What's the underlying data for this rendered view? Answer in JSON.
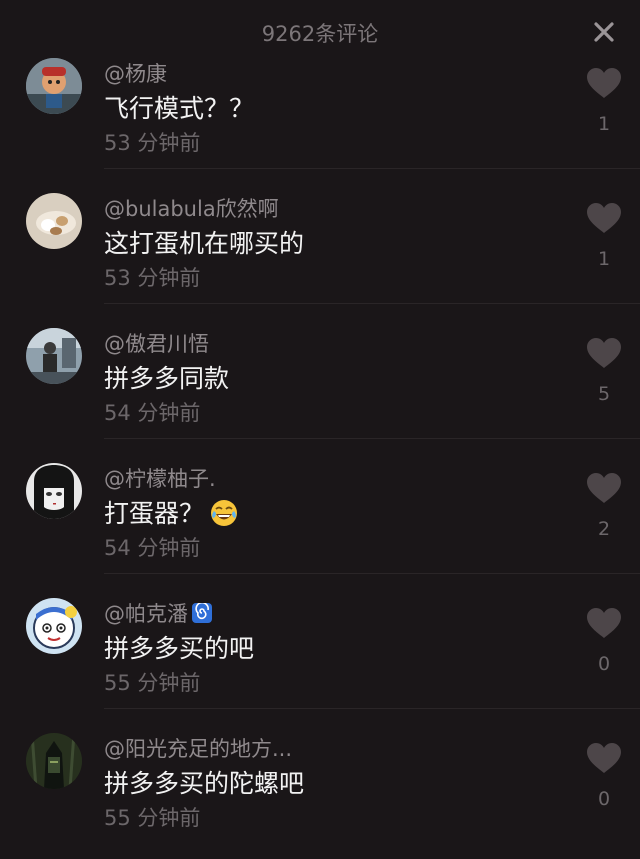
{
  "header": {
    "title": "9262条评论"
  },
  "comments": [
    {
      "username": "@杨康",
      "text": "飞行模式？？",
      "time": "53 分钟前",
      "likes": "1",
      "avatar_icon": "cartoon-figure-avatar"
    },
    {
      "username": "@bulabula欣然啊",
      "text": "这打蛋机在哪买的",
      "time": "53 分钟前",
      "likes": "1",
      "avatar_icon": "food-photo-avatar"
    },
    {
      "username": "@傲君川悟",
      "text": "拼多多同款",
      "time": "54 分钟前",
      "likes": "5",
      "avatar_icon": "person-photo-avatar"
    },
    {
      "username": "@柠檬柚子.",
      "text": "打蛋器？",
      "time": "54 分钟前",
      "likes": "2",
      "avatar_icon": "anime-girl-avatar"
    },
    {
      "username": "@帕克潘",
      "text": "拼多多买的吧",
      "time": "55 分钟前",
      "likes": "0",
      "avatar_icon": "cartoon-face-avatar"
    },
    {
      "username": "@阳光充足的地方...",
      "text": "拼多多买的陀螺吧",
      "time": "55 分钟前",
      "likes": "0",
      "avatar_icon": "dark-character-avatar"
    }
  ],
  "colors": {
    "background": "#1a1618",
    "text": "#f2f2f2",
    "secondary": "#8f898c",
    "muted": "#6c676a"
  }
}
